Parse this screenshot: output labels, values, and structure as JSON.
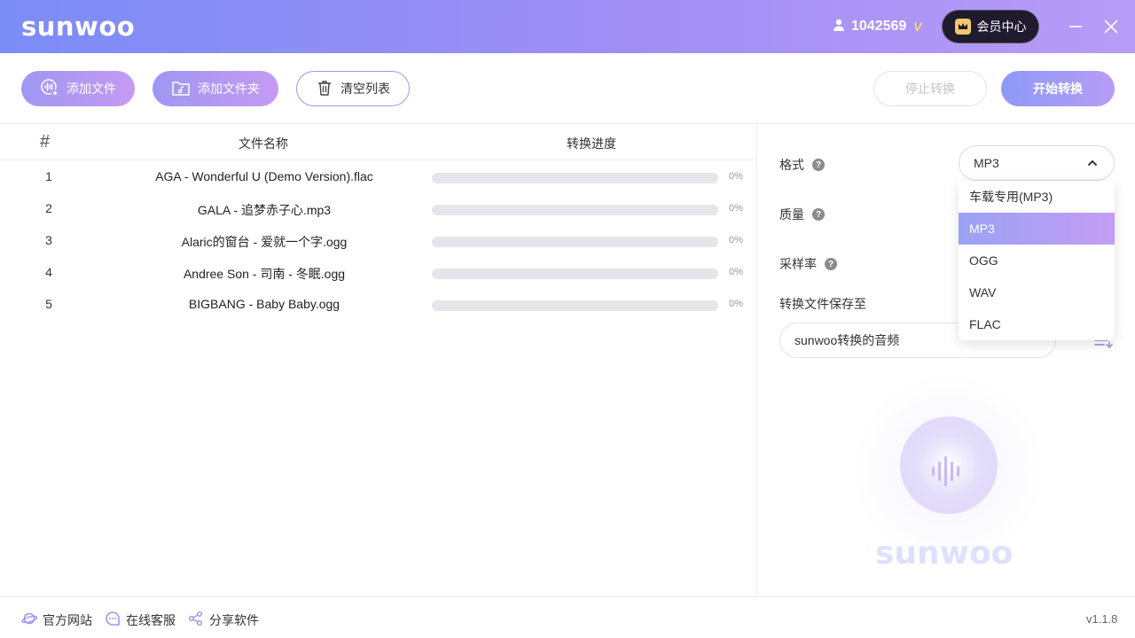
{
  "app": {
    "logo": "sunwoo",
    "user_id": "1042569",
    "vip_mark": "V",
    "member_center": "会员中心"
  },
  "toolbar": {
    "add_file": "添加文件",
    "add_folder": "添加文件夹",
    "clear_list": "清空列表",
    "stop": "停止转换",
    "start": "开始转换"
  },
  "table": {
    "headers": {
      "num": "#",
      "name": "文件名称",
      "progress": "转换进度"
    },
    "rows": [
      {
        "num": "1",
        "name": "AGA - Wonderful U (Demo Version).flac",
        "progress": 0,
        "progress_label": "0%"
      },
      {
        "num": "2",
        "name": "GALA - 追梦赤子心.mp3",
        "progress": 0,
        "progress_label": "0%"
      },
      {
        "num": "3",
        "name": "Alaric的窗台 - 爱就一个字.ogg",
        "progress": 0,
        "progress_label": "0%"
      },
      {
        "num": "4",
        "name": "Andree Son - 司南 - 冬眠.ogg",
        "progress": 0,
        "progress_label": "0%"
      },
      {
        "num": "5",
        "name": "BIGBANG - Baby Baby.ogg",
        "progress": 0,
        "progress_label": "0%"
      }
    ]
  },
  "settings": {
    "format_label": "格式",
    "format_value": "MP3",
    "format_options": [
      "车载专用(MP3)",
      "MP3",
      "OGG",
      "WAV",
      "FLAC"
    ],
    "format_selected_index": 1,
    "quality_label": "质量",
    "sample_rate_label": "采样率",
    "save_to_label": "转换文件保存至",
    "save_path": "sunwoo转换的音频",
    "help_glyph": "?"
  },
  "brand": {
    "watermark": "sunwoo"
  },
  "footer": {
    "site": "官方网站",
    "service": "在线客服",
    "share": "分享软件",
    "version": "v1.1.8"
  },
  "colors": {
    "accent_start": "#8d9af6",
    "accent_end": "#b79cf6",
    "titlebar_start": "#7c8cf7",
    "titlebar_end": "#b79cf7",
    "member_bg": "#1f1a2e"
  },
  "icons": {
    "user": "user-icon",
    "crown": "crown-icon",
    "minimize": "minimize-icon",
    "close": "close-icon",
    "add_file": "audio-file-add-icon",
    "add_folder": "music-folder-icon",
    "clear": "trash-icon",
    "chevron": "chevron-up-icon",
    "folder_path": "folder-list-icon",
    "site": "planet-icon",
    "service": "chat-icon",
    "share": "share-icon"
  }
}
